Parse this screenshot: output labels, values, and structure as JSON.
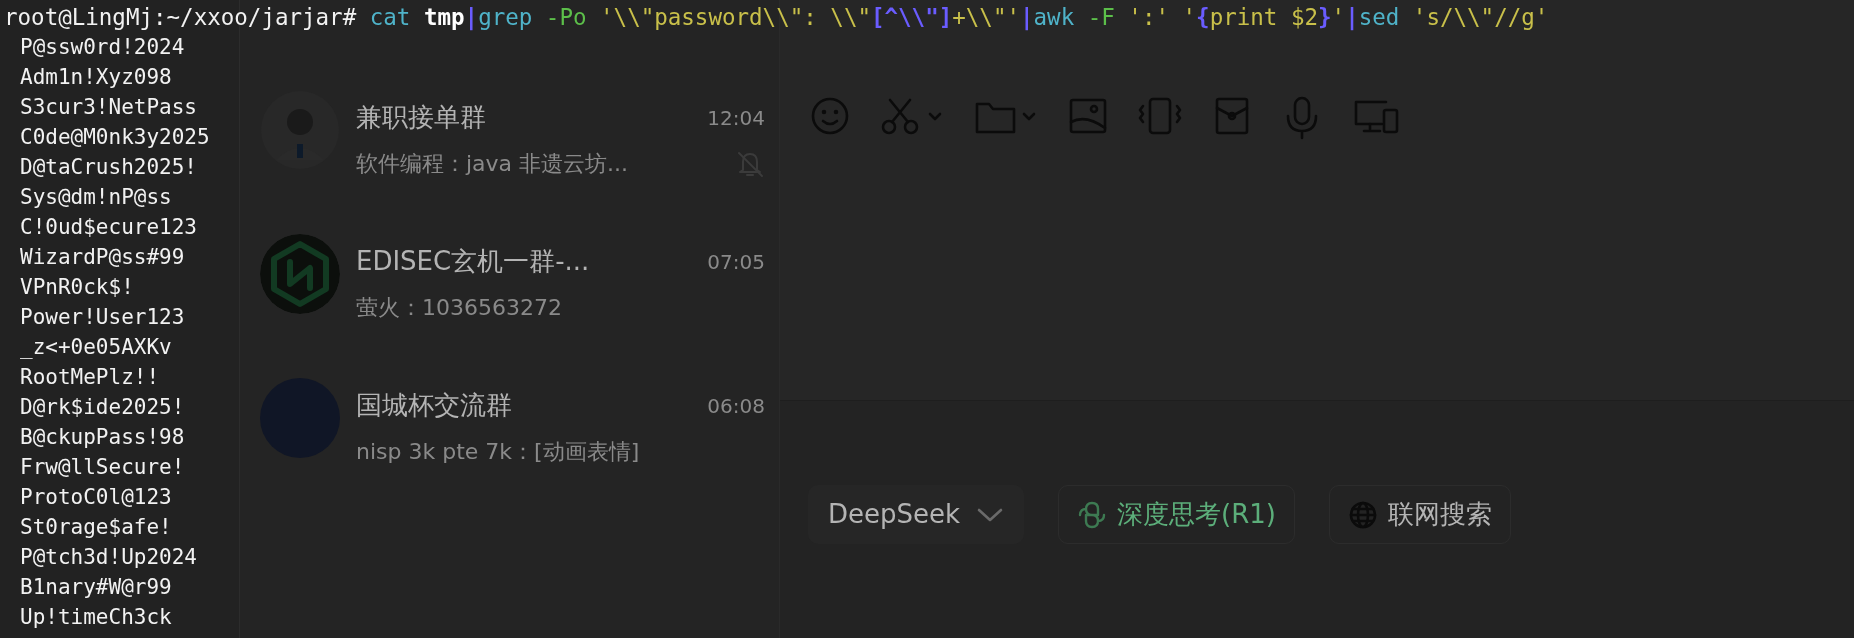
{
  "terminal": {
    "command": [
      {
        "kind": "prompt",
        "text": "root@LingMj:~/xxoo/jarjar#"
      },
      {
        "kind": "command",
        "text": " cat"
      },
      {
        "kind": "path",
        "text": " tmp"
      },
      {
        "kind": "pipe",
        "text": "|"
      },
      {
        "kind": "command",
        "text": "grep"
      },
      {
        "kind": "option",
        "text": " -Po"
      },
      {
        "kind": "string",
        "text": " '\\\\\"password\\\\\": \\\\\""
      },
      {
        "kind": "regex",
        "text": "[^\\\\\"]"
      },
      {
        "kind": "string",
        "text": "+\\\\\"'"
      },
      {
        "kind": "pipe",
        "text": "|"
      },
      {
        "kind": "command",
        "text": "awk"
      },
      {
        "kind": "option",
        "text": " -F"
      },
      {
        "kind": "string",
        "text": " ':' '"
      },
      {
        "kind": "regex",
        "text": "{"
      },
      {
        "kind": "string",
        "text": "print $2"
      },
      {
        "kind": "regex",
        "text": "}"
      },
      {
        "kind": "string",
        "text": "'"
      },
      {
        "kind": "pipe",
        "text": "|"
      },
      {
        "kind": "command",
        "text": "sed"
      },
      {
        "kind": "string",
        "text": " 's/\\\\\"//g'"
      }
    ],
    "output": [
      "P@ssw0rd!2024",
      "Adm1n!Xyz098",
      "S3cur3!NetPass",
      "C0de@M0nk3y2025",
      "D@taCrush2025!",
      "Sys@dm!nP@ss",
      "C!0ud$ecure123",
      "WizardP@ss#99",
      "VPnR0ck$!",
      "Power!User123",
      "_z<+0e05AXKv",
      "RootMePlz!!",
      "D@rk$ide2025!",
      "B@ckupPass!98",
      "Frw@llSecure!",
      "ProtoC0l@123",
      "St0rage$afe!",
      "P@tch3d!Up2024",
      "B1nary#W@r99",
      "Up!timeCh3ck"
    ]
  },
  "chats": [
    {
      "kind": "person",
      "name": "兼职接单群",
      "time": "12:04",
      "preview": "软件编程：java 非遗云坊...",
      "muted": true
    },
    {
      "kind": "logo",
      "name": "EDISEC玄机一群-...",
      "time": "07:05",
      "preview": "萤火：1036563272",
      "muted": false
    },
    {
      "kind": "photo",
      "name": "国城杯交流群",
      "time": "06:08",
      "preview": "nisp 3k pte 7k：[动画表情]",
      "muted": false
    }
  ],
  "input_bar": {
    "model": "DeepSeek",
    "buttons": [
      {
        "kind": "think",
        "label": "深度思考(R1)"
      },
      {
        "kind": "search",
        "label": "联网搜索"
      }
    ]
  }
}
